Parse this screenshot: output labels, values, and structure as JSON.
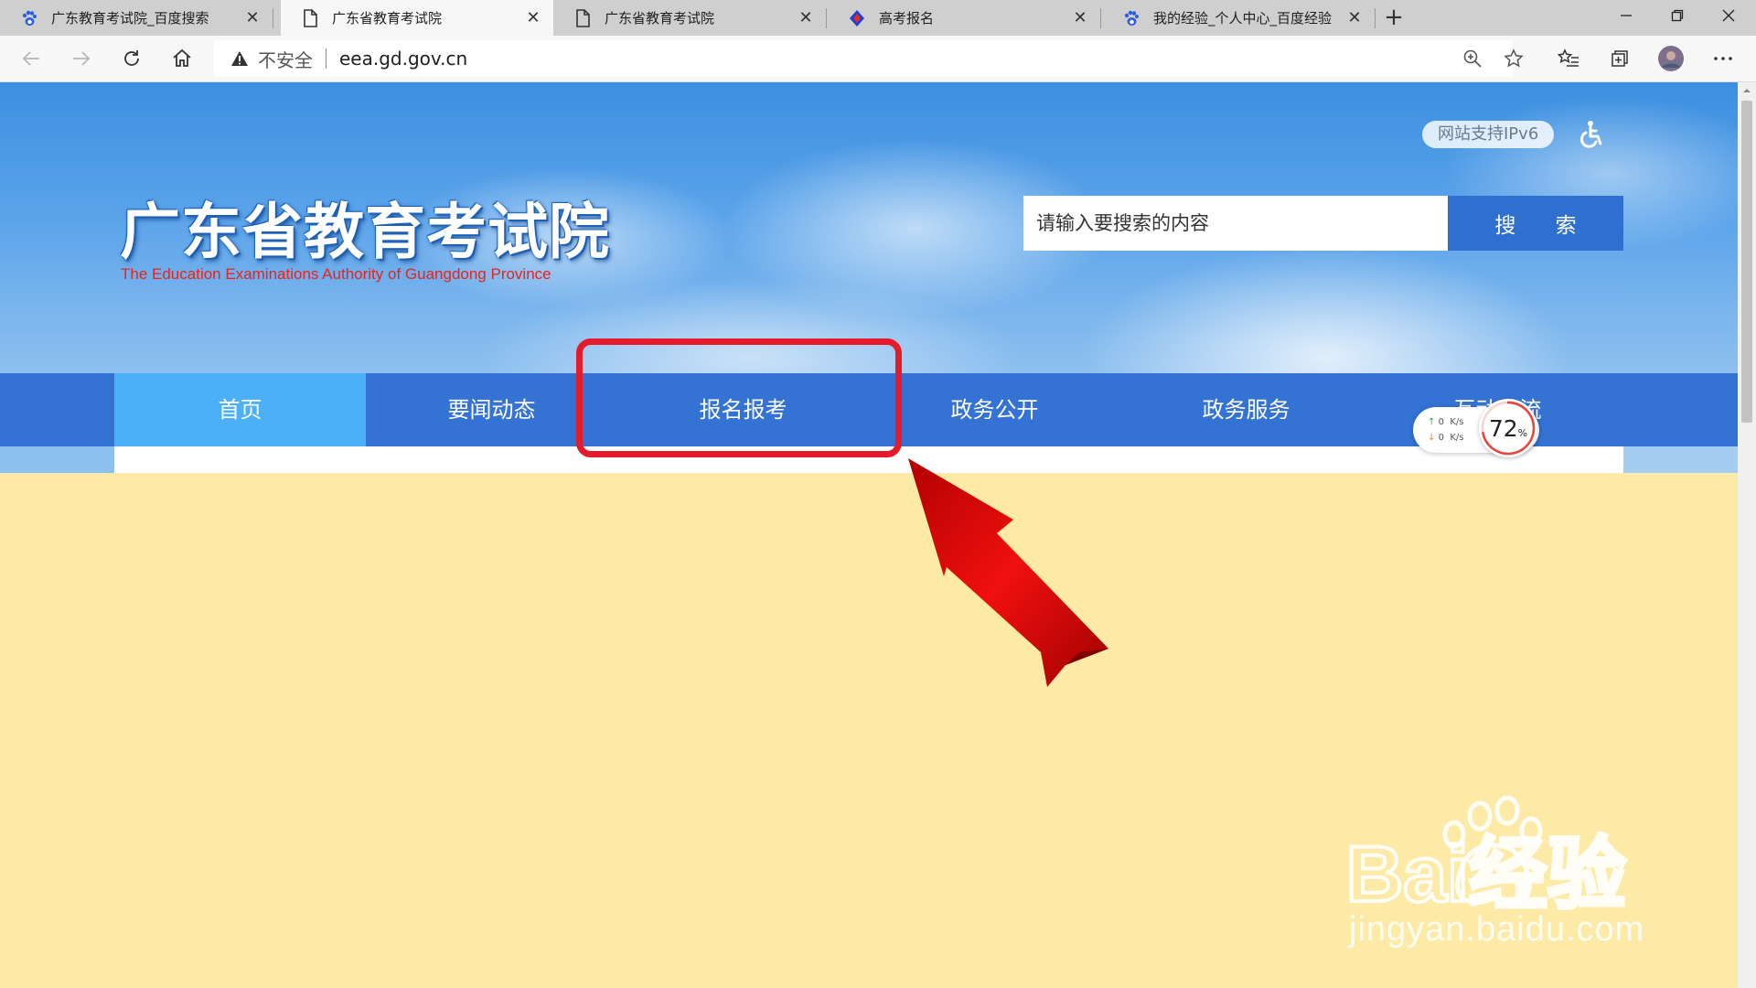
{
  "browser": {
    "tabs": [
      {
        "title": "广东教育考试院_百度搜索",
        "favicon": "baidu-paw-icon",
        "active": false
      },
      {
        "title": "广东省教育考试院",
        "favicon": "page-icon",
        "active": true
      },
      {
        "title": "广东省教育考试院",
        "favicon": "page-icon",
        "active": false
      },
      {
        "title": "高考报名",
        "favicon": "gaokao-logo-icon",
        "active": false
      },
      {
        "title": "我的经验_个人中心_百度经验",
        "favicon": "baidu-paw-icon",
        "active": false
      }
    ],
    "close_glyph": "✕",
    "new_tab_glyph": "+",
    "address": {
      "security_label": "不安全",
      "url": "eea.gd.gov.cn"
    }
  },
  "header": {
    "logo_cn": "广东省教育考试院",
    "logo_en": "The Education Examinations Authority of Guangdong Province",
    "ipv6_badge": "网站支持IPv6",
    "search_placeholder": "请输入要搜索的内容",
    "search_button": "搜 索"
  },
  "nav": {
    "items": [
      "首页",
      "要闻动态",
      "报名报考",
      "政务公开",
      "政务服务",
      "互动交流"
    ],
    "active_index": 0,
    "highlighted_index": 2
  },
  "speed_widget": {
    "upload": "0",
    "download": "0",
    "unit": "K/s",
    "percent": "72",
    "percent_sign": "%"
  },
  "watermark": {
    "logo_text": "Bai经验",
    "url_text": "jingyan.baidu.com"
  },
  "colors": {
    "nav_bg": "#3473d4",
    "nav_active": "#4cb0f7",
    "annotation_red": "#e51a2a",
    "page_bg": "#fdeaa6"
  }
}
